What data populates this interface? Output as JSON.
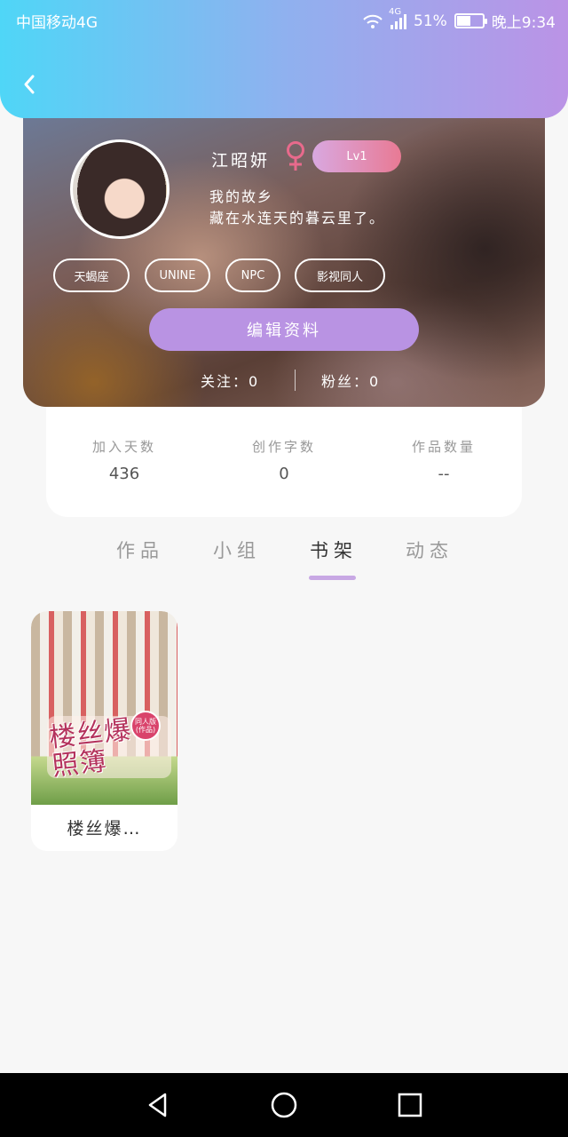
{
  "status_bar": {
    "carrier": "中国移动4G",
    "network_badge": "4G",
    "battery": "51%",
    "time": "晚上9:34"
  },
  "header": {
    "back_icon": "chevron-left-icon"
  },
  "profile": {
    "name": "江昭妍",
    "gender_icon": "female-icon",
    "level": "Lv1",
    "bio_line1": "我的故乡",
    "bio_line2": "藏在水连天的暮云里了。",
    "tags": [
      "天蝎座",
      "UNINE",
      "NPC",
      "影视同人"
    ],
    "edit_label": "编辑资料",
    "following": "关注：0",
    "fans": "粉丝：0"
  },
  "stats": [
    {
      "label": "加入天数",
      "value": "436"
    },
    {
      "label": "创作字数",
      "value": "0"
    },
    {
      "label": "作品数量",
      "value": "--"
    }
  ],
  "tabs": [
    {
      "label": "作品",
      "active": false
    },
    {
      "label": "小组",
      "active": false
    },
    {
      "label": "书架",
      "active": true
    },
    {
      "label": "动态",
      "active": false
    }
  ],
  "shelf": [
    {
      "title": "楼丝爆…",
      "cover_text": "楼丝爆照簿",
      "cover_seal": "同人版(作品)"
    }
  ],
  "nav": {
    "back": "triangle-back-icon",
    "home": "circle-home-icon",
    "recents": "square-recents-icon"
  },
  "colors": {
    "accent": "#b993e3",
    "header_start": "#4fd6f7",
    "header_end": "#bb93e6",
    "female": "#e86a8c"
  }
}
